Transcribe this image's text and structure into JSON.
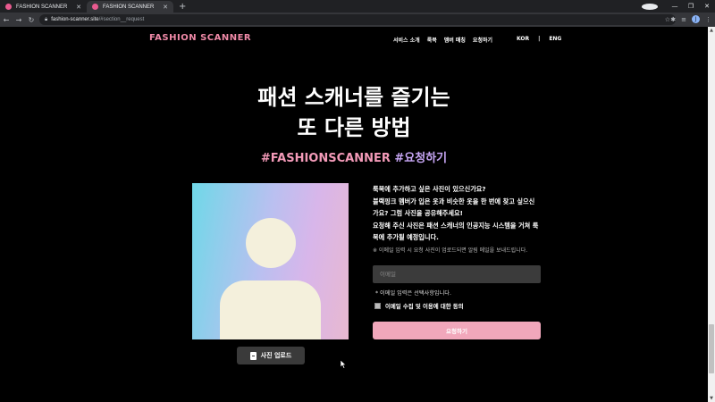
{
  "browser": {
    "tabs": [
      {
        "title": "FASHION SCANNER",
        "close": "✕"
      },
      {
        "title": "FASHION SCANNER",
        "close": "✕"
      }
    ],
    "new_tab": "+",
    "window_controls": [
      "—",
      "❐",
      "✕"
    ],
    "address": {
      "host": "fashion-scanner.site",
      "path": "/#section__request"
    },
    "avatar_initial": "J"
  },
  "header": {
    "logo": "FASHION SCANNER",
    "nav": [
      "서비스 소개",
      "룩북",
      "멤버 매칭",
      "요청하기"
    ],
    "lang": {
      "kor": "KOR",
      "sep": "|",
      "eng": "ENG"
    }
  },
  "hero": {
    "line1": "패션 스캐너를 즐기는",
    "line2": "또 다른 방법",
    "hashtag1": "#FASHIONSCANNER",
    "hashtag2": "#요청하기"
  },
  "request": {
    "desc": [
      "룩북에 추가하고 싶은 사진이 있으신가요?",
      "블랙핑크 멤버가 입은 옷과 비슷한 옷을 한 번에 찾고 싶으신",
      "가요? 그럼 사진을 공유해주세요!",
      "요청해 주신 사진은 패션 스캐너의 인공지능 시스템을 거쳐 룩",
      "북에 추가될 예정입니다."
    ],
    "note": "※ 이메일 입력 시 요청 사진이 업로드되면 알림 메일을 보내드립니다.",
    "email_placeholder": "이메일",
    "email_value": "",
    "optional_note": "* 이메일 입력은 선택사항입니다.",
    "agree_label": "이메일 수집 및 이용에 대한 동의",
    "agree_checked": false,
    "submit_label": "요청하기",
    "upload_label": "사진 업로드"
  },
  "colors": {
    "brand_pink": "#f08aa8",
    "hashtag_purple": "#c7a6f5",
    "submit_bg": "#f1a7bb"
  }
}
